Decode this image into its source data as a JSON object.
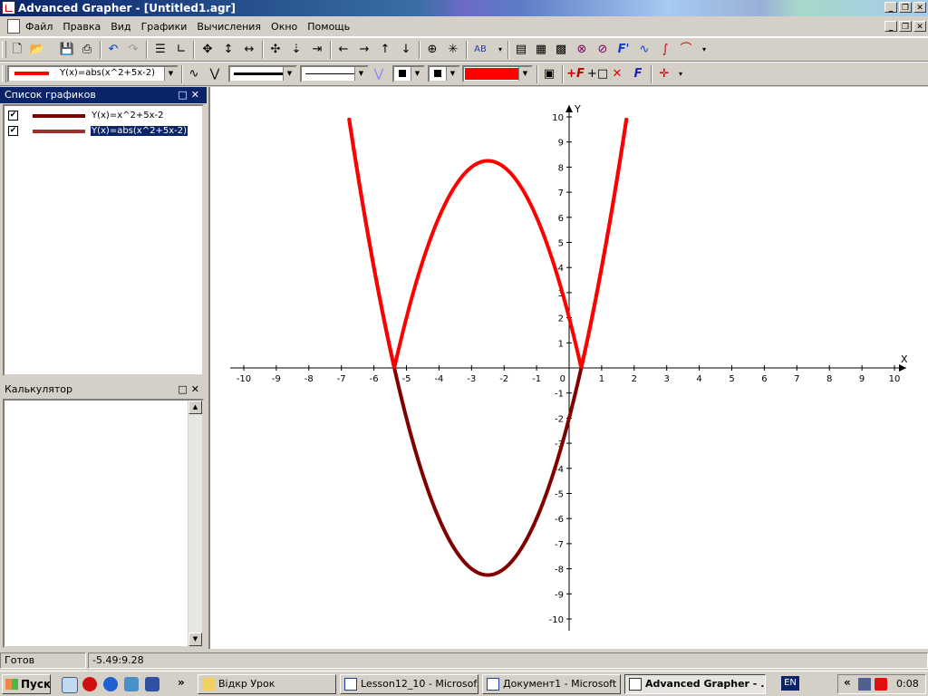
{
  "window": {
    "title": "Advanced Grapher - [Untitled1.agr]",
    "min_glyph": "_",
    "restore_glyph": "❐",
    "close_glyph": "✕"
  },
  "menu": {
    "items": [
      "Файл",
      "Правка",
      "Вид",
      "Графики",
      "Вычисления",
      "Окно",
      "Помощь"
    ]
  },
  "toolbar2": {
    "selected_graph": "Y(x)=abs(x^2+5x-2)",
    "accent_color": "#ff0000"
  },
  "graph_list": {
    "title": "Список графиков",
    "items": [
      {
        "label": "Y(x)=x^2+5x-2",
        "checked": true,
        "color": "#800000",
        "selected": false
      },
      {
        "label": "Y(x)=abs(x^2+5x-2)",
        "checked": true,
        "color": "#a03030",
        "selected": true
      }
    ]
  },
  "calculator": {
    "title": "Калькулятор"
  },
  "plot": {
    "x_axis_label": "X",
    "y_axis_label": "Y",
    "x_range": [
      -10,
      10
    ],
    "y_range": [
      -10,
      10
    ],
    "x_ticks": [
      -10,
      -9,
      -8,
      -7,
      -6,
      -5,
      -4,
      -3,
      -2,
      -1,
      0,
      1,
      2,
      3,
      4,
      5,
      6,
      7,
      8,
      9,
      10
    ],
    "y_ticks": [
      -10,
      -9,
      -8,
      -7,
      -6,
      -5,
      -4,
      -3,
      -2,
      -1,
      1,
      2,
      3,
      4,
      5,
      6,
      7,
      8,
      9,
      10
    ],
    "origin_label": "0",
    "curves": [
      {
        "expr": "x^2+5x-2",
        "color": "#800000"
      },
      {
        "expr": "abs(x^2+5x-2)",
        "color": "#ff0000"
      }
    ]
  },
  "status": {
    "state": "Готов",
    "cursor_coords": "-5.49:9.28"
  },
  "taskbar": {
    "start_label": "Пуск",
    "quicklaunch_more": "»",
    "buttons": [
      {
        "label": "Відкр Урок",
        "active": false
      },
      {
        "label": "Lesson12_10 - Microsof...",
        "active": false
      },
      {
        "label": "Документ1 - Microsoft ...",
        "active": false
      },
      {
        "label": "Advanced Grapher - ...",
        "active": true
      }
    ],
    "lang": "EN",
    "tray_more": "«",
    "clock": "0:08"
  }
}
